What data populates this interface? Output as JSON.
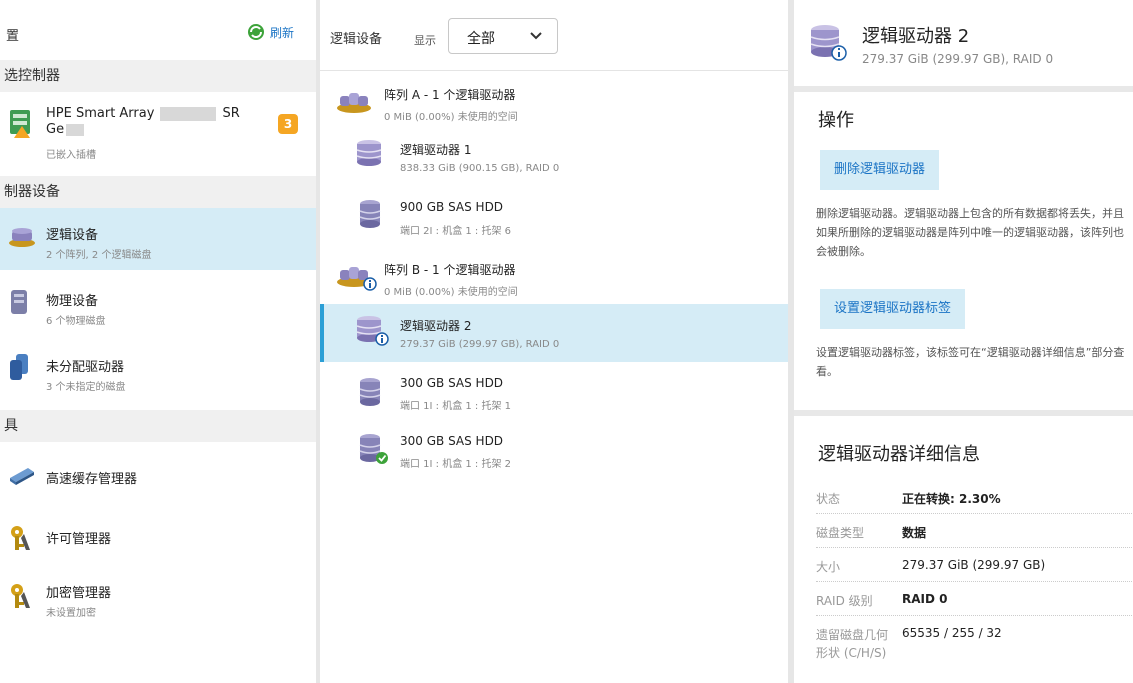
{
  "left": {
    "header_title": "置",
    "refresh_label": "刷新",
    "sections": {
      "controller": "选控制器",
      "devices": "制器设备",
      "tools": "具"
    },
    "controller": {
      "name_prefix": "HPE Smart Array",
      "name_suffix": "SR",
      "name_line2": "Ge",
      "sub": "已嵌入插槽",
      "badge": "3"
    },
    "items": [
      {
        "label": "逻辑设备",
        "sub": "2 个阵列, 2 个逻辑磁盘"
      },
      {
        "label": "物理设备",
        "sub": "6 个物理磁盘"
      },
      {
        "label": "未分配驱动器",
        "sub": "3 个未指定的磁盘"
      }
    ],
    "tools": [
      {
        "label": "高速缓存管理器"
      },
      {
        "label": "许可管理器"
      },
      {
        "label": "加密管理器",
        "sub": "未设置加密"
      }
    ]
  },
  "middle": {
    "title": "逻辑设备",
    "show_label": "显示",
    "filter_value": "全部",
    "rows": [
      {
        "name": "阵列 A - 1 个逻辑驱动器",
        "sub": "0 MiB (0.00%) 未使用的空间"
      },
      {
        "name": "逻辑驱动器 1",
        "sub": "838.33 GiB (900.15 GB), RAID 0"
      },
      {
        "name": "900 GB SAS HDD",
        "sub": "端口 2I : 机盒 1 : 托架 6"
      },
      {
        "name": "阵列 B - 1 个逻辑驱动器",
        "sub": "0 MiB (0.00%) 未使用的空间"
      },
      {
        "name": "逻辑驱动器 2",
        "sub": "279.37 GiB (299.97 GB), RAID 0"
      },
      {
        "name": "300 GB SAS HDD",
        "sub": "端口 1I : 机盒 1 : 托架 1"
      },
      {
        "name": "300 GB SAS HDD",
        "sub": "端口 1I : 机盒 1 : 托架 2"
      }
    ]
  },
  "right": {
    "title": "逻辑驱动器 2",
    "subtitle": "279.37 GiB (299.97 GB), RAID 0",
    "ops_title": "操作",
    "delete_button": "删除逻辑驱动器",
    "delete_desc": "删除逻辑驱动器。逻辑驱动器上包含的所有数据都将丢失，并且如果所删除的逻辑驱动器是阵列中唯一的逻辑驱动器，该阵列也会被删除。",
    "label_button": "设置逻辑驱动器标签",
    "label_desc": "设置逻辑驱动器标签，该标签可在“逻辑驱动器详细信息”部分查看。",
    "details_title": "逻辑驱动器详细信息",
    "details": [
      {
        "k": "状态",
        "v": "正在转换: 2.30%"
      },
      {
        "k": "磁盘类型",
        "v": "数据"
      },
      {
        "k": "大小",
        "v": "279.37 GiB (299.97 GB)"
      },
      {
        "k": "RAID 级别",
        "v": "RAID 0"
      },
      {
        "k": "遗留磁盘几何形状 (C/H/S)",
        "v": "65535 / 255 / 32"
      }
    ]
  },
  "colors": {
    "accent": "#1b74c5",
    "selected_bg": "#d5ecf6",
    "badge": "#f5a623",
    "section_bg": "#f0f0f0"
  }
}
